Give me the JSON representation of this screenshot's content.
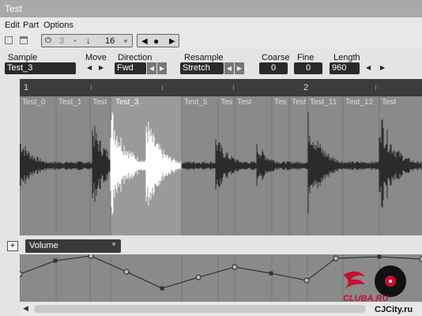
{
  "window": {
    "title": "Test"
  },
  "menu": [
    "Edit",
    "Part",
    "Options"
  ],
  "toolbar": {
    "snap_num": "3",
    "snap_div": "16",
    "snap_dot": "•"
  },
  "params": {
    "sample_label": "Sample",
    "sample_value": "Test_3",
    "move_label": "Move",
    "direction_label": "Direction",
    "direction_value": "Fwd",
    "resample_label": "Resample",
    "resample_value": "Stretch",
    "coarse_label": "Coarse",
    "coarse_value": "0",
    "fine_label": "Fine",
    "fine_value": "0",
    "length_label": "Length",
    "length_value": "960"
  },
  "ruler": {
    "marks": [
      "1",
      "2"
    ]
  },
  "slices": [
    "Test_0",
    "Test_1",
    "Test",
    "Test_3",
    "Test_5",
    "Tes",
    "Test",
    "Tes",
    "Test",
    "Test_11",
    "Test_12",
    "Test"
  ],
  "active_slice": "Test_3",
  "automation": {
    "parameter": "Volume",
    "add_label": "+"
  },
  "watermark": {
    "brand": "CLUBA.RU",
    "site": "CJCity.ru"
  },
  "colors": {
    "accent_red": "#c8102e",
    "wave_bg": "#8a8a8a",
    "wave_fg": "#2b2b2b",
    "active_wave": "#ffffff"
  }
}
